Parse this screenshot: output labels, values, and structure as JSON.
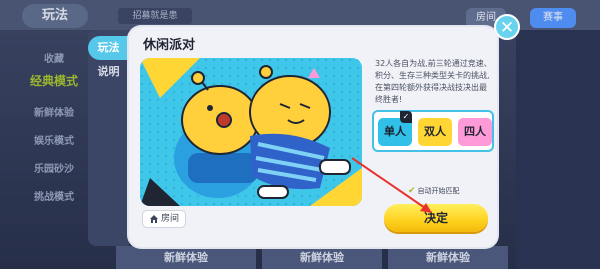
{
  "background": {
    "top_title": "玩法",
    "top_badge": "招募就是患",
    "room_button": "房间",
    "event_button": "赛事",
    "left_nav": [
      "收藏",
      "经典模式",
      "新鲜体验",
      "娱乐模式",
      "乐园砂沙",
      "挑战模式"
    ],
    "bottom_tabs": [
      "新鲜体验",
      "新鲜体验",
      "新鲜体验"
    ],
    "colors": {
      "bg": "#2c3550",
      "accent_green": "#9bb62f"
    }
  },
  "modal": {
    "side_tabs": [
      {
        "label": "玩法",
        "active": true
      },
      {
        "label": "说明",
        "active": false
      }
    ],
    "title": "休闲派对",
    "description": "32人各自为战,前三轮通过竞速、积分、生存三种类型关卡的挑战,在第四轮额外获得决战技决出最终胜者!",
    "room_label": "房间",
    "modes": [
      {
        "label": "单人",
        "selected": true,
        "color": "#30c0e8"
      },
      {
        "label": "双人",
        "selected": false,
        "color": "#ffd633"
      },
      {
        "label": "四人",
        "selected": false,
        "color": "#ff9ad8"
      }
    ],
    "auto_match_label": "自动开始匹配",
    "confirm_label": "决定",
    "close_icon": "close-icon",
    "colors": {
      "panel": "#f1f2f7",
      "accent": "#43c1e6",
      "confirm": "#ffd21f"
    }
  }
}
